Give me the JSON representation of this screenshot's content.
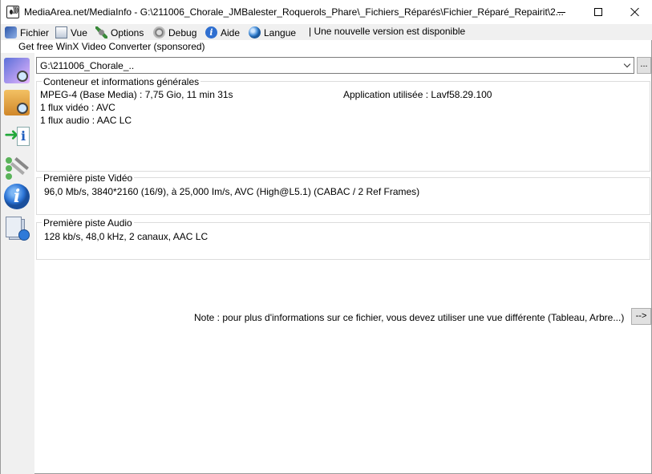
{
  "window": {
    "title": "MediaArea.net/MediaInfo - G:\\211006_Chorale_JMBalester_Roquerols_Phare\\_Fichiers_Réparés\\Fichier_Réparé_Repairit\\2..."
  },
  "menu": {
    "items": [
      {
        "label": "Fichier",
        "icon": "file-menu-icon"
      },
      {
        "label": "Vue",
        "icon": "view-menu-icon"
      },
      {
        "label": "Options",
        "icon": "options-menu-icon"
      },
      {
        "label": "Debug",
        "icon": "debug-menu-icon"
      },
      {
        "label": "Aide",
        "icon": "help-menu-icon"
      },
      {
        "label": "Langue",
        "icon": "language-menu-icon"
      }
    ],
    "update_notice": "| Une nouvelle version est disponible",
    "sponsor": "Get free WinX Video Converter (sponsored)"
  },
  "file_select": {
    "value": "G:\\211006_Chorale_..",
    "browse_label": "..."
  },
  "general": {
    "title": "Conteneur et informations générales",
    "format_line": "MPEG-4 (Base Media) : 7,75 Gio, 11 min 31s",
    "application_line": "Application utilisée : Lavf58.29.100",
    "video_streams": "1 flux vidéo : AVC",
    "audio_streams": "1 flux audio : AAC LC"
  },
  "video": {
    "title": "Première piste Vidéo",
    "details": "96,0 Mb/s, 3840*2160 (16/9), à 25,000 Im/s, AVC (High@L5.1) (CABAC / 2 Ref Frames)"
  },
  "audio": {
    "title": "Première piste Audio",
    "details": "128 kb/s, 48,0 kHz, 2 canaux, AAC LC"
  },
  "note": {
    "text": "Note : pour plus d'informations sur ce fichier, vous devez utiliser une vue différente (Tableau, Arbre...)",
    "button_label": "-->"
  }
}
